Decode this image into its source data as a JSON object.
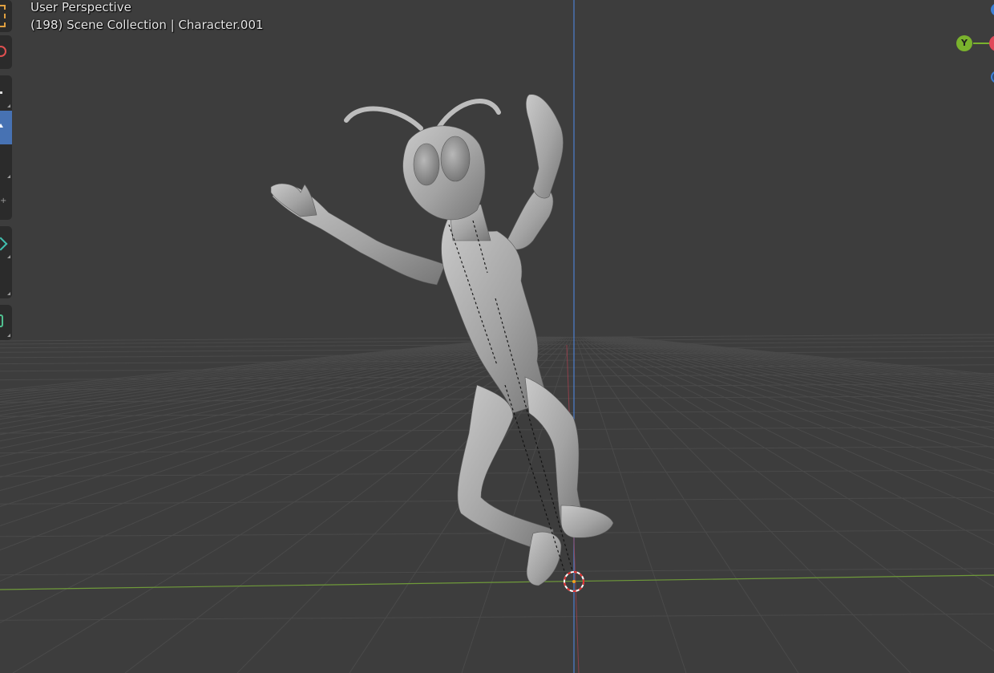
{
  "viewport": {
    "view_name": "User Perspective",
    "frame": "(198)",
    "collection": "Scene Collection",
    "separator": "|",
    "object_name": "Character.001",
    "background_color": "#3d3d3d",
    "grid_color": "#4a4a4a",
    "x_axis_color": "#6f9a3a",
    "z_axis_color": "#4d7fcf"
  },
  "gizmo": {
    "y_axis_label": "Y",
    "y_color": "#7ab22d",
    "x_color": "#e04a5a",
    "z_color": "#3c7fd6"
  },
  "toolbar": {
    "tools": [
      {
        "name": "select-box",
        "icon": "select-box-icon"
      },
      {
        "name": "cursor",
        "icon": "cursor-icon"
      },
      {
        "name": "move",
        "icon": "move-icon"
      },
      {
        "name": "rotate",
        "icon": "rotate-icon",
        "active": true
      },
      {
        "name": "scale",
        "icon": "scale-icon"
      },
      {
        "name": "transform",
        "icon": "transform-icon"
      },
      {
        "name": "annotate",
        "icon": "annotate-icon"
      },
      {
        "name": "measure",
        "icon": "measure-icon"
      },
      {
        "name": "add-cube",
        "icon": "add-cube-icon"
      }
    ]
  }
}
